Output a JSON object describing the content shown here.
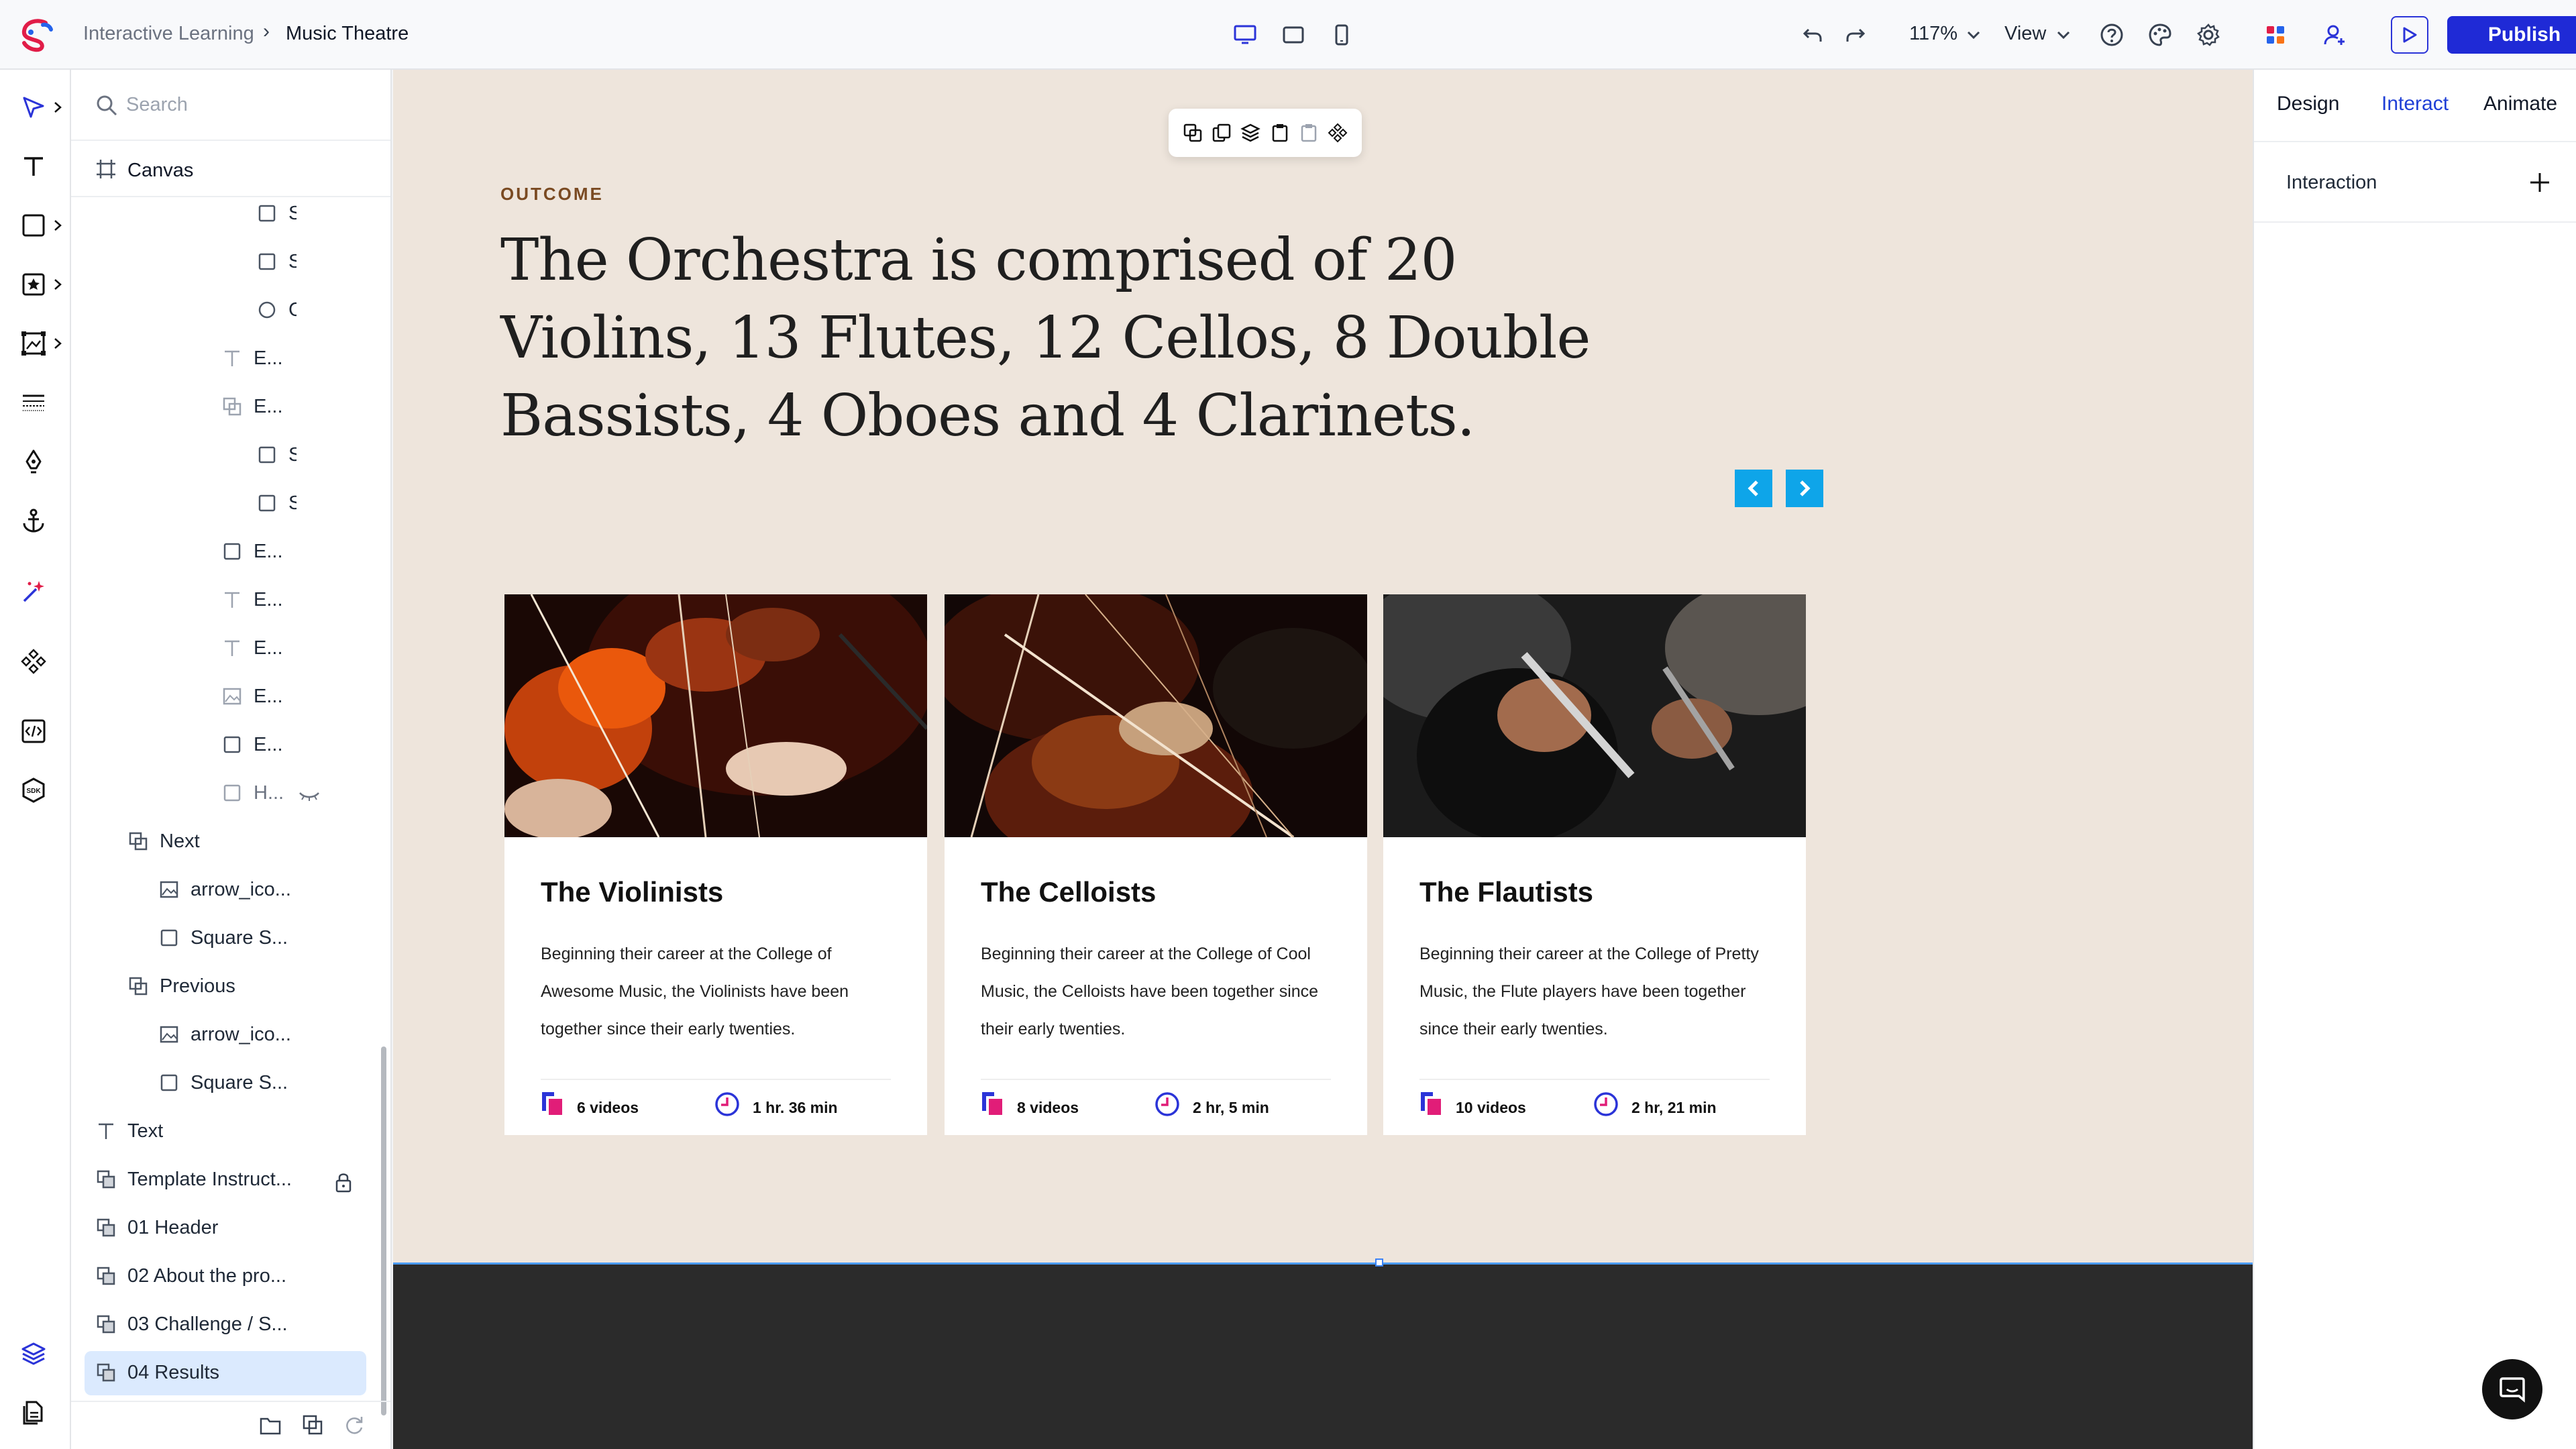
{
  "topbar": {
    "breadcrumb_parent": "Interactive Learning",
    "breadcrumb_separator": "›",
    "breadcrumb_current": "Music Theatre",
    "zoom": "117%",
    "view_label": "View",
    "publish_label": "Publish"
  },
  "layers": {
    "search_placeholder": "Search",
    "canvas_label": "Canvas",
    "items": [
      {
        "label": "S"
      },
      {
        "label": "S"
      },
      {
        "label": "C"
      },
      {
        "label": "E..."
      },
      {
        "label": "E..."
      },
      {
        "label": "S"
      },
      {
        "label": "S"
      },
      {
        "label": "E..."
      },
      {
        "label": "E..."
      },
      {
        "label": "E..."
      },
      {
        "label": "E..."
      },
      {
        "label": "E..."
      },
      {
        "label": "H..."
      },
      {
        "label": "Next"
      },
      {
        "label": "arrow_ico..."
      },
      {
        "label": "Square S..."
      },
      {
        "label": "Previous"
      },
      {
        "label": "arrow_ico..."
      },
      {
        "label": "Square S..."
      },
      {
        "label": "Text"
      },
      {
        "label": "Template Instruct..."
      },
      {
        "label": "01 Header"
      },
      {
        "label": "02 About the pro..."
      },
      {
        "label": "03 Challenge / S..."
      },
      {
        "label": "04 Results"
      }
    ]
  },
  "right_panel": {
    "tabs": [
      {
        "label": "Design"
      },
      {
        "label": "Interact"
      },
      {
        "label": "Animate"
      }
    ],
    "active_tab": "Interact",
    "interaction_label": "Interaction"
  },
  "canvas": {
    "eyebrow": "OUTCOME",
    "headline": "The Orchestra is comprised of 20 Violins, 13 Flutes, 12 Cellos, 8 Double Bassists, 4 Oboes and 4 Clarinets.",
    "cards": [
      {
        "title": "The Violinists",
        "desc": "Beginning their career at the College of Awesome Music, the Violinists have been together since their early twenties.",
        "videos": "6 videos",
        "duration": "1 hr. 36 min"
      },
      {
        "title": "The Celloists",
        "desc": "Beginning their career at the College of Cool Music, the Celloists have been together since their early twenties.",
        "videos": "8 videos",
        "duration": "2 hr, 5 min"
      },
      {
        "title": "The Flautists",
        "desc": "Beginning their career at the College of Pretty Music, the Flute players have been together since their early twenties.",
        "videos": "10 videos",
        "duration": "2 hr, 21 min"
      }
    ]
  },
  "colors": {
    "accent": "#1f2ad6",
    "canvas_bg": "#eee5dc",
    "nav_button": "#0ea5e9",
    "selection": "#dbeafe",
    "dark_section": "#2b2b2b"
  }
}
